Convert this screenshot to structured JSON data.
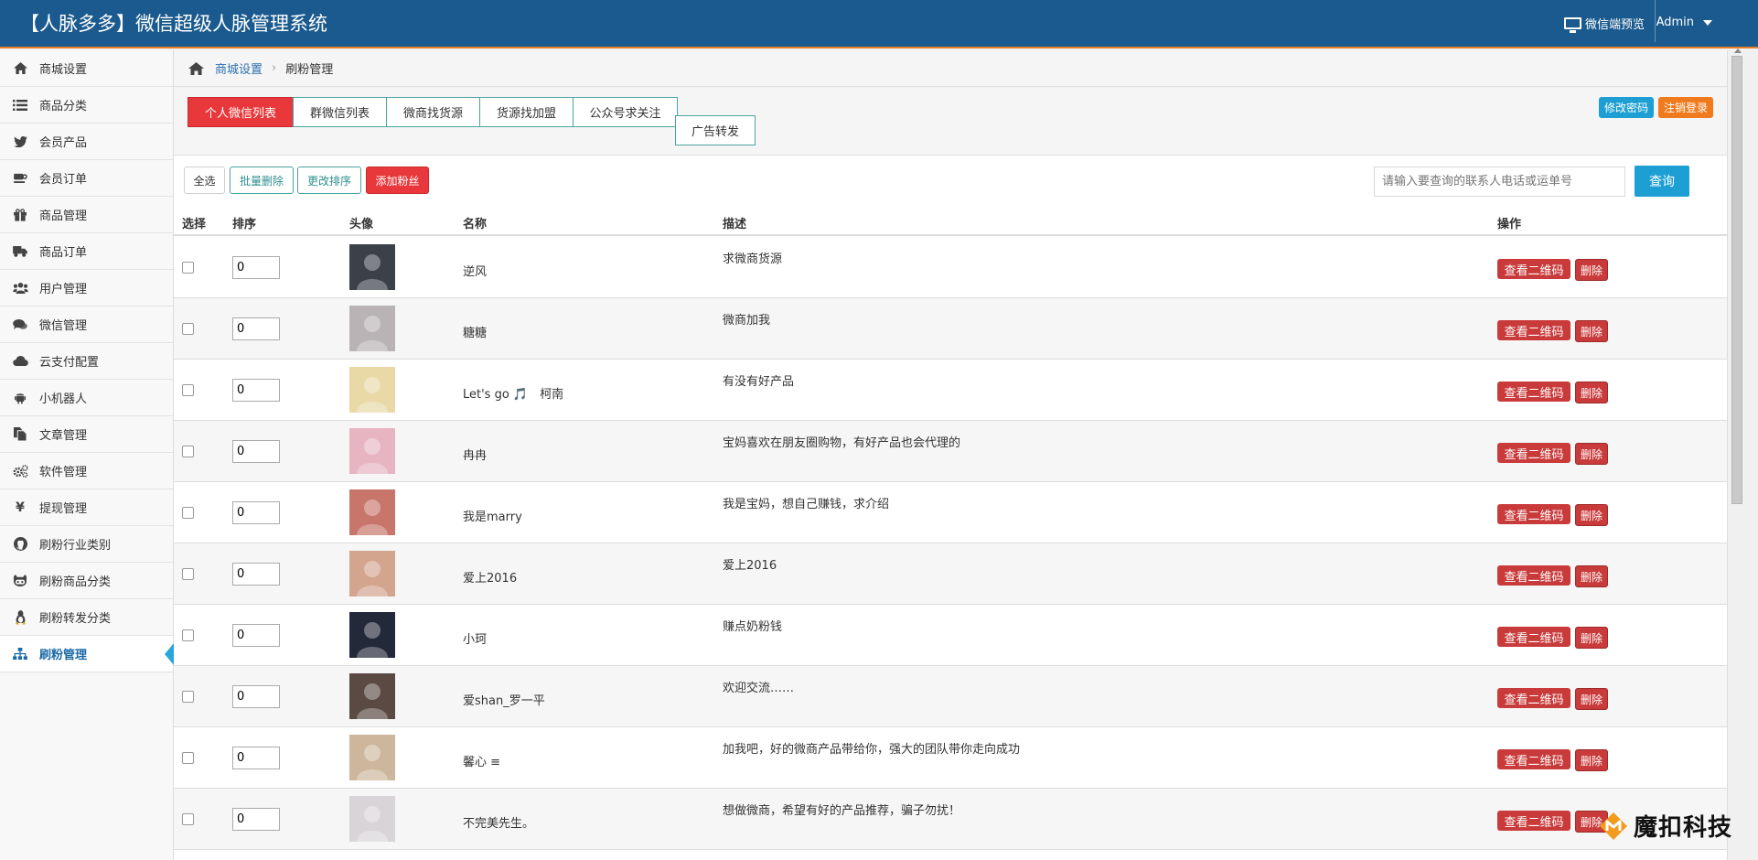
{
  "header": {
    "title": "【人脉多多】微信超级人脉管理系统",
    "preview_label": "微信端预览",
    "user_label": "Admin"
  },
  "sidebar": {
    "items": [
      {
        "label": "商城设置",
        "icon": "home-icon"
      },
      {
        "label": "商品分类",
        "icon": "list-icon"
      },
      {
        "label": "会员产品",
        "icon": "twitter-icon"
      },
      {
        "label": "会员订单",
        "icon": "coffee-cup-icon"
      },
      {
        "label": "商品管理",
        "icon": "gift-icon"
      },
      {
        "label": "商品订单",
        "icon": "truck-icon"
      },
      {
        "label": "用户管理",
        "icon": "users-icon"
      },
      {
        "label": "微信管理",
        "icon": "chat-icon"
      },
      {
        "label": "云支付配置",
        "icon": "cloud-icon"
      },
      {
        "label": "小机器人",
        "icon": "android-icon"
      },
      {
        "label": "文章管理",
        "icon": "files-icon"
      },
      {
        "label": "软件管理",
        "icon": "cogs-icon"
      },
      {
        "label": "提现管理",
        "icon": "yen-icon"
      },
      {
        "label": "刷粉行业类别",
        "icon": "github-icon"
      },
      {
        "label": "刷粉商品分类",
        "icon": "github-alt-icon"
      },
      {
        "label": "刷粉转发分类",
        "icon": "linux-icon"
      },
      {
        "label": "刷粉管理",
        "icon": "sitemap-icon",
        "active": true
      }
    ]
  },
  "breadcrumb": {
    "root": "商城设置",
    "current": "刷粉管理"
  },
  "tabs": [
    {
      "label": "个人微信列表",
      "active": true
    },
    {
      "label": "群微信列表"
    },
    {
      "label": "微商找货源"
    },
    {
      "label": "货源找加盟"
    },
    {
      "label": "公众号求关注"
    },
    {
      "label": "广告转发"
    }
  ],
  "top_actions": {
    "change_password": "修改密码",
    "logout": "注销登录"
  },
  "toolbar": {
    "select_all": "全选",
    "batch_delete": "批量删除",
    "change_sort": "更改排序",
    "add_fan": "添加粉丝",
    "search_placeholder": "请输入要查询的联系人电话或运单号",
    "search_button": "查询"
  },
  "table": {
    "columns": [
      "选择",
      "排序",
      "头像",
      "名称",
      "描述",
      "操作"
    ],
    "qr_label": "查看二维码",
    "delete_label": "删除",
    "rows": [
      {
        "sort": "0",
        "name": "逆风",
        "desc": "求微商货源",
        "avatar_color": "#3b4049"
      },
      {
        "sort": "0",
        "name": "糖糖",
        "desc": "微商加我",
        "avatar_color": "#b9b3b6"
      },
      {
        "sort": "0",
        "name": "Let's go 🎵　柯南",
        "desc": "有没有好产品",
        "avatar_color": "#e8d9a6"
      },
      {
        "sort": "0",
        "name": "冉冉",
        "desc": "宝妈喜欢在朋友圈购物，有好产品也会代理的",
        "avatar_color": "#e7b4c2"
      },
      {
        "sort": "0",
        "name": "我是marry",
        "desc": "我是宝妈，想自己赚钱，求介绍",
        "avatar_color": "#c8766b"
      },
      {
        "sort": "0",
        "name": "爱上2016",
        "desc": "爱上2016",
        "avatar_color": "#d3a48e"
      },
      {
        "sort": "0",
        "name": "小珂",
        "desc": "赚点奶粉钱",
        "avatar_color": "#24293a"
      },
      {
        "sort": "0",
        "name": "爱shan_罗一平",
        "desc": "欢迎交流……",
        "avatar_color": "#5b4a44"
      },
      {
        "sort": "0",
        "name": "馨心 ≡",
        "desc": "加我吧，好的微商产品带给你，强大的团队带你走向成功",
        "avatar_color": "#cdb79c"
      },
      {
        "sort": "0",
        "name": "不完美先生。",
        "desc": "想做微商，希望有好的产品推荐，骗子勿扰！",
        "avatar_color": "#d8d4d8"
      }
    ]
  },
  "watermark": {
    "text": "魔扣科技"
  },
  "colors": {
    "header_bg": "#1b5a8e",
    "header_border": "#e87d2a",
    "active_tab": "#e8383b",
    "danger": "#c93a3a",
    "primary": "#1e9fd3",
    "accent_orange": "#f07b1e"
  }
}
